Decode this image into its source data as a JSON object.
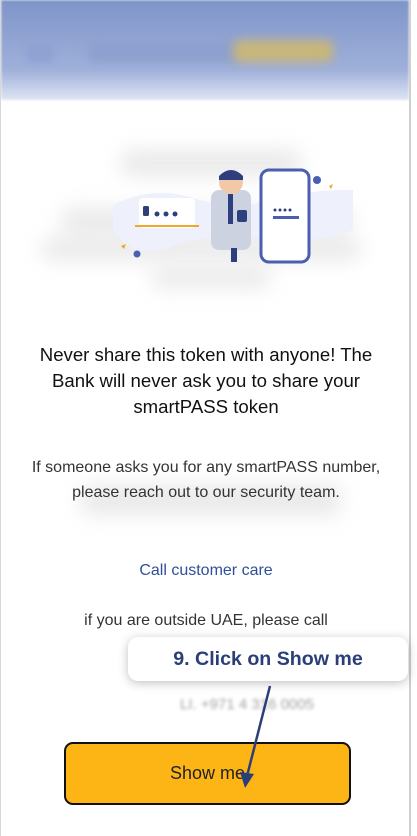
{
  "warning": {
    "headline": "Never share this token with anyone! The Bank will never ask you to share your smartPASS token",
    "body": "If someone asks you for any smartPASS number, please reach out to our security team."
  },
  "links": {
    "call_customer_care": "Call customer care"
  },
  "outside_uae_text": "if you are outside UAE, please call",
  "phone_partial": "LI. +971 4 316 0005",
  "annotation": {
    "step_label": "9. Click on Show me"
  },
  "show_button_label": "Show me",
  "colors": {
    "header": "#8da0d0",
    "button": "#fdb516",
    "link": "#2f4f9a",
    "callout_text": "#2a3f7a"
  },
  "icons": [
    "menu-icon",
    "token-illustration-icon",
    "arrow-pointer-icon"
  ]
}
